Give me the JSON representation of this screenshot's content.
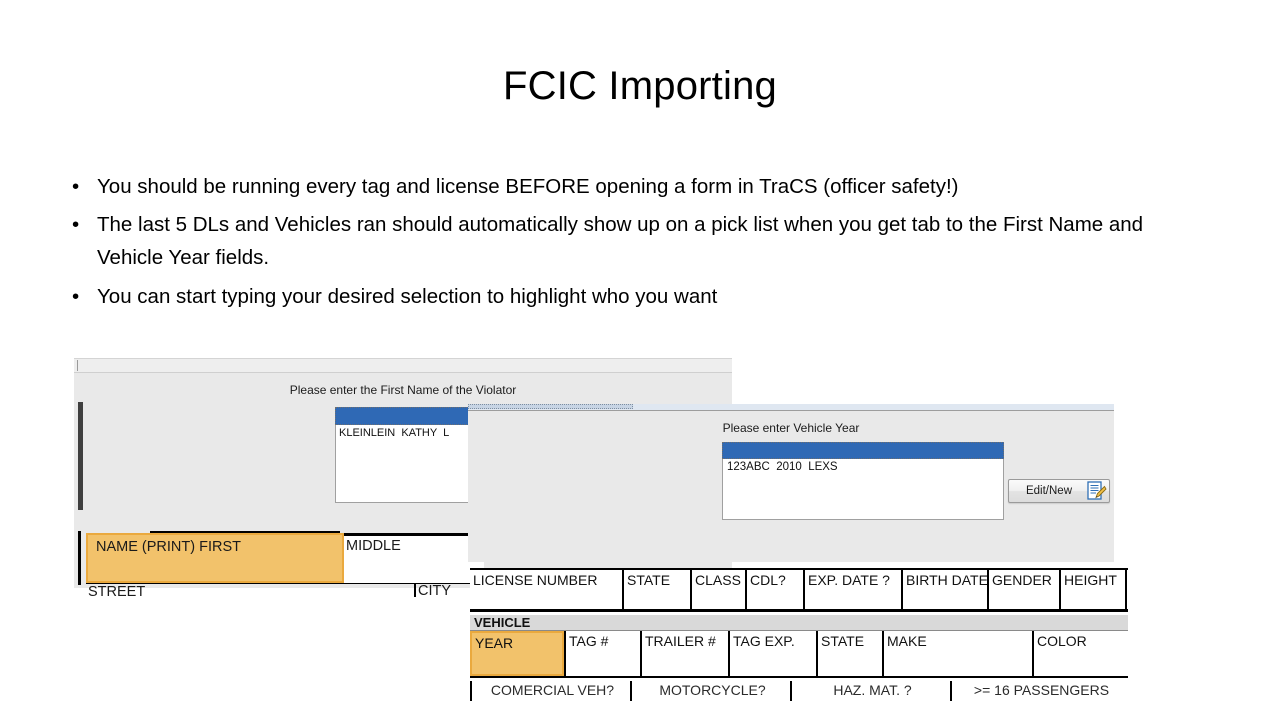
{
  "slide": {
    "title": "FCIC Importing",
    "bullet_marker": "•",
    "bullets": [
      "You should be running every tag and license BEFORE opening a form in TraCS (officer safety!)",
      "The last 5 DLs and Vehicles ran should automatically show up on a pick list when you get tab to the First Name and Vehicle Year fields.",
      "You can start typing your desired selection to highlight who you want"
    ]
  },
  "colors": {
    "selection_blue": "#2f69b5",
    "highlight_orange": "#f2c26b",
    "highlight_orange_border": "#eaa93e",
    "dialog_gray": "#e9e9e9"
  },
  "first_name_picker": {
    "prompt": "Please enter the First Name of the Violator",
    "list_items": [
      "KLEINLEIN  KATHY  L"
    ],
    "selected_value": ""
  },
  "vehicle_year_picker": {
    "prompt": "Please enter Vehicle Year",
    "list_items": [
      "123ABC  2010  LEXS"
    ],
    "selected_value": "",
    "edit_new_button": "Edit/New"
  },
  "person_form": {
    "fields": [
      {
        "label": "NAME (PRINT) FIRST",
        "highlighted": true
      },
      {
        "label": "MIDDLE",
        "highlighted": false
      },
      {
        "label": "STREET",
        "highlighted": false
      },
      {
        "label": "CITY",
        "highlighted": false
      }
    ]
  },
  "dl_table": {
    "headers": [
      "LICENSE NUMBER",
      "STATE",
      "CLASS",
      "CDL?",
      "EXP. DATE ?",
      "BIRTH DATE",
      "GENDER",
      "HEIGHT"
    ]
  },
  "vehicle_table": {
    "section_label": "VEHICLE",
    "headers": [
      "YEAR",
      "TAG #",
      "TRAILER #",
      "TAG EXP.",
      "STATE",
      "MAKE",
      "COLOR"
    ],
    "highlighted_header": "YEAR",
    "sub_headers": [
      "COMERCIAL VEH?",
      "MOTORCYCLE?",
      "HAZ. MAT. ?",
      ">= 16 PASSENGERS"
    ]
  }
}
